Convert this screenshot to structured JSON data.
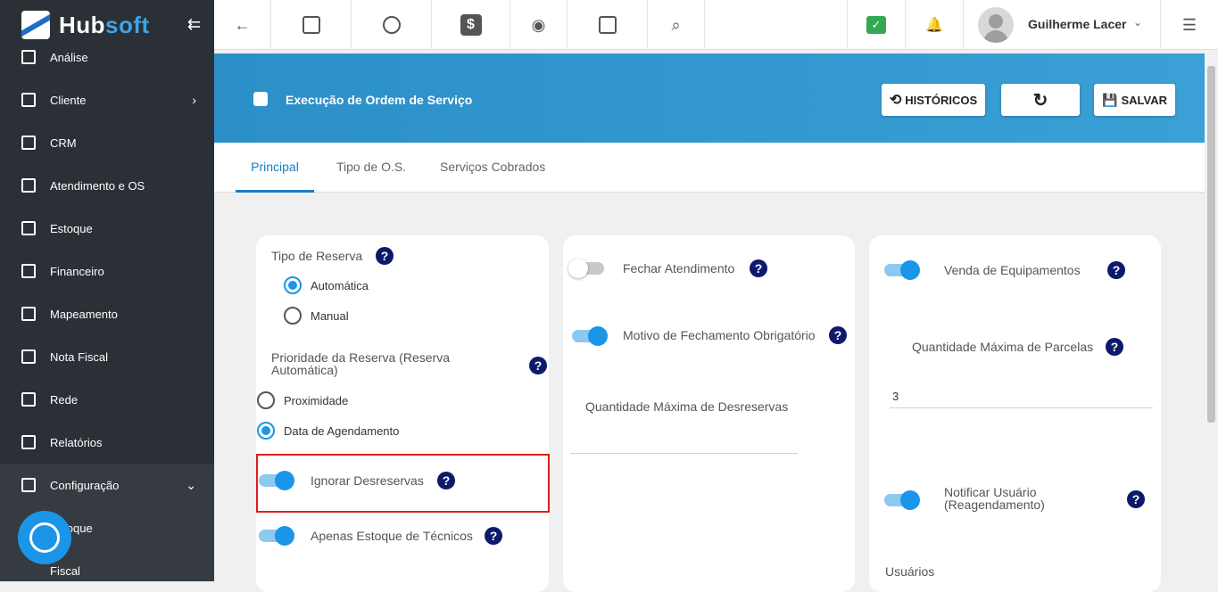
{
  "app": {
    "brand_hub": "Hub",
    "brand_soft": "soft"
  },
  "sidebar": {
    "items": [
      {
        "label": "Análise",
        "icon": "chart-icon"
      },
      {
        "label": "Cliente",
        "icon": "person-icon",
        "chevron": "›"
      },
      {
        "label": "CRM",
        "icon": "crm-icon"
      },
      {
        "label": "Atendimento e OS",
        "icon": "calendar-clock-icon"
      },
      {
        "label": "Estoque",
        "icon": "box-icon"
      },
      {
        "label": "Financeiro",
        "icon": "money-icon"
      },
      {
        "label": "Mapeamento",
        "icon": "map-pin-icon"
      },
      {
        "label": "Nota Fiscal",
        "icon": "document-icon"
      },
      {
        "label": "Rede",
        "icon": "server-icon"
      },
      {
        "label": "Relatórios",
        "icon": "report-icon"
      },
      {
        "label": "Configuração",
        "icon": "gear-icon",
        "chevron": "⌄"
      },
      {
        "label": "Estoque",
        "icon": "none"
      },
      {
        "label": "Fiscal",
        "icon": "none"
      }
    ],
    "collapse_glyph": "⇇"
  },
  "topbar": {
    "user_name": "Guilherme Lacer",
    "user_chevron": "⌄",
    "back_glyph": "←",
    "dollar_glyph": "$",
    "check_glyph": "✓",
    "eye_glyph": "◉",
    "search_glyph": "⌕",
    "bell_glyph": "🔔",
    "menu_glyph": "☰"
  },
  "banner": {
    "title": "Execução de Ordem de Serviço",
    "historicos_label": "HISTÓRICOS",
    "refresh_glyph": "↻",
    "salvar_label": "SALVAR",
    "history_glyph": "⟲",
    "save_glyph": "💾"
  },
  "tabs": [
    {
      "label": "Principal",
      "active": true
    },
    {
      "label": "Tipo de O.S.",
      "active": false
    },
    {
      "label": "Serviços Cobrados",
      "active": false
    }
  ],
  "col1": {
    "tipo_reserva": "Tipo de Reserva",
    "automatica": "Automática",
    "manual": "Manual",
    "prioridade": "Prioridade da Reserva (Reserva Automática)",
    "proximidade": "Proximidade",
    "data_agendamento": "Data de Agendamento",
    "ignorar": "Ignorar Desreservas",
    "apenas": "Apenas Estoque de Técnicos",
    "tipo_reserva_selected": "Automática",
    "prioridade_selected": "Data de Agendamento",
    "ignorar_on": true,
    "apenas_on": true
  },
  "col2": {
    "fechar": "Fechar Atendimento",
    "motivo": "Motivo de Fechamento Obrigatório",
    "qtd_desreservas": "Quantidade Máxima de Desreservas",
    "fechar_on": false,
    "motivo_on": true
  },
  "col3": {
    "venda": "Venda de Equipamentos",
    "qtd_parcelas": "Quantidade Máxima de Parcelas",
    "qtd_parcelas_value": "3",
    "notificar": "Notificar Usuário (Reagendamento)",
    "usuarios": "Usuários",
    "venda_on": true,
    "notificar_on": true
  },
  "help_glyph": "?"
}
